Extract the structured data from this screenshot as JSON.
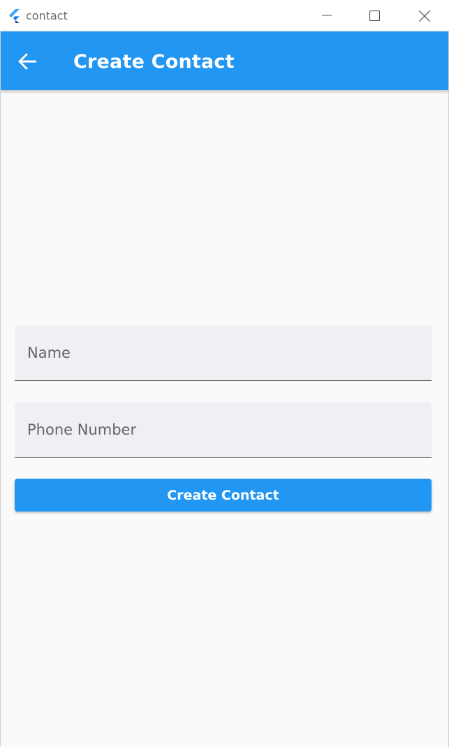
{
  "window": {
    "title": "contact",
    "icons": {
      "app": "flutter-logo-icon",
      "minimize": "minimize-icon",
      "maximize": "maximize-icon",
      "close": "close-icon"
    }
  },
  "appbar": {
    "title": "Create Contact",
    "back_icon": "arrow-left-icon",
    "color": "#2196f3"
  },
  "form": {
    "name": {
      "placeholder": "Name",
      "value": ""
    },
    "phone": {
      "placeholder": "Phone Number",
      "value": ""
    },
    "submit_label": "Create Contact"
  },
  "colors": {
    "primary": "#2196f3",
    "background": "#fafafa",
    "field_fill": "#f0eff4"
  }
}
